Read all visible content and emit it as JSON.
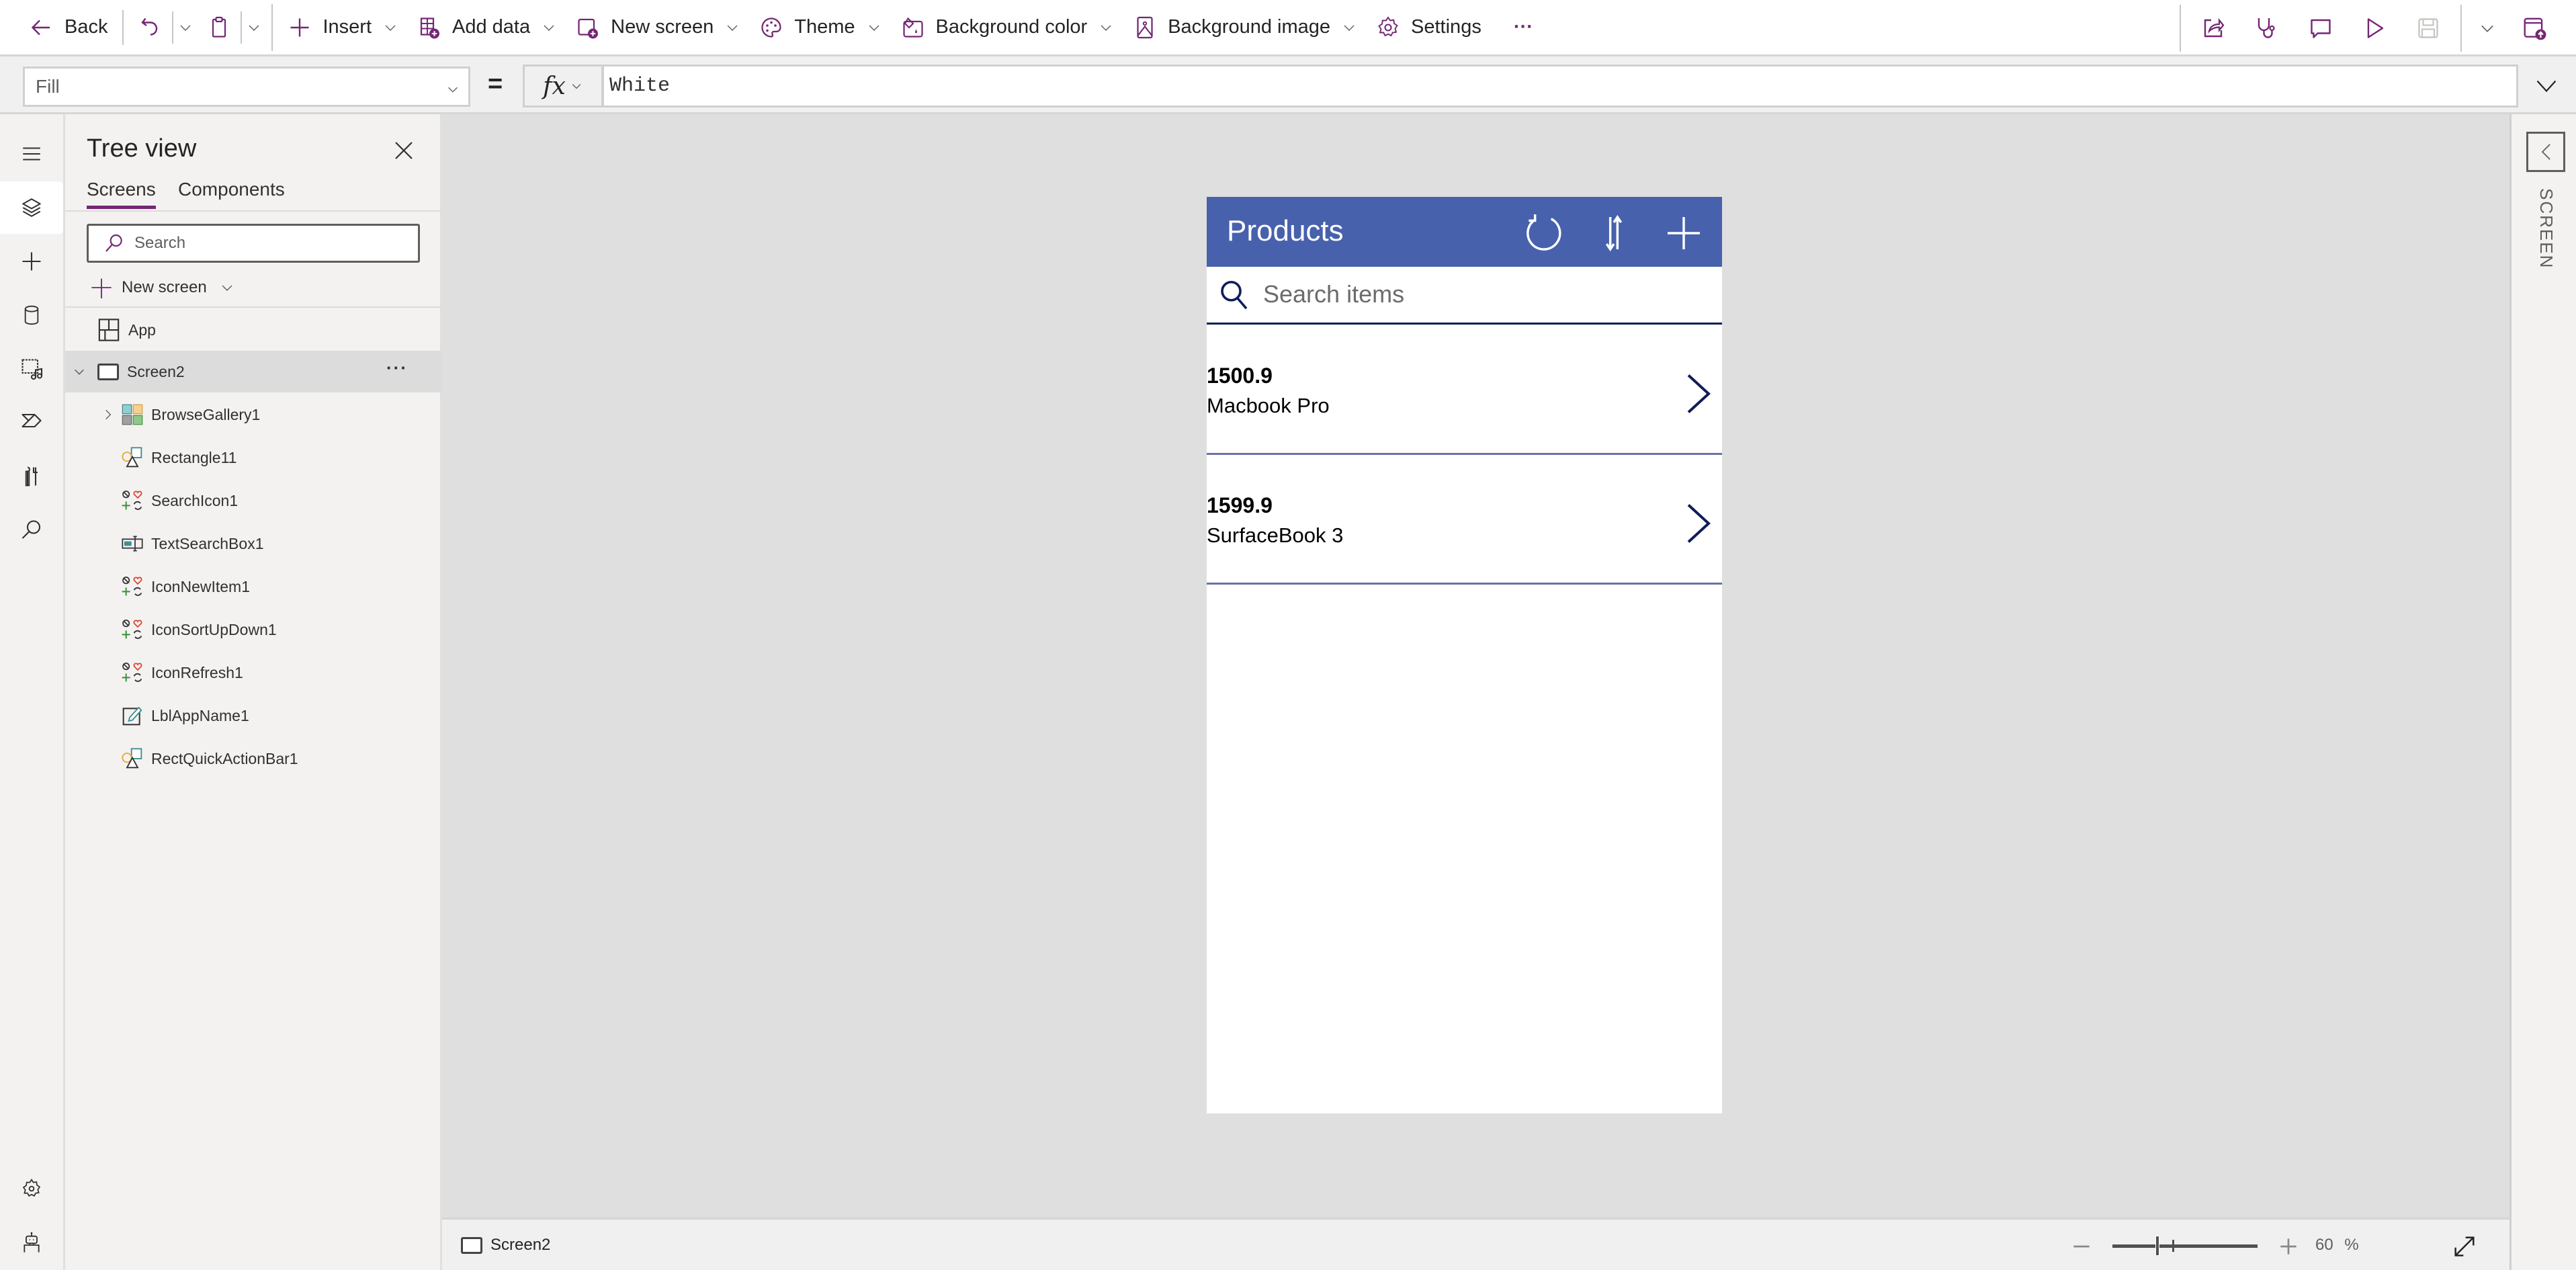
{
  "toolbar": {
    "back_label": "Back",
    "insert_label": "Insert",
    "add_data_label": "Add data",
    "new_screen_label": "New screen",
    "theme_label": "Theme",
    "background_color_label": "Background color",
    "background_image_label": "Background image",
    "settings_label": "Settings",
    "more_label": "···",
    "accent_color": "#742774"
  },
  "formula_bar": {
    "property": "Fill",
    "equals": "=",
    "fx_label": "fx",
    "formula": "White"
  },
  "tree_view": {
    "title": "Tree view",
    "tabs": [
      {
        "label": "Screens",
        "active": true
      },
      {
        "label": "Components",
        "active": false
      }
    ],
    "search_placeholder": "Search",
    "new_screen_label": "New screen",
    "app_label": "App",
    "screen": {
      "label": "Screen2",
      "expanded": true,
      "selected": true
    },
    "controls": [
      {
        "label": "BrowseGallery1",
        "icon": "gallery-icon",
        "expandable": true
      },
      {
        "label": "Rectangle11",
        "icon": "shapes-icon"
      },
      {
        "label": "SearchIcon1",
        "icon": "icons-control-icon"
      },
      {
        "label": "TextSearchBox1",
        "icon": "text-input-icon"
      },
      {
        "label": "IconNewItem1",
        "icon": "icons-control-icon"
      },
      {
        "label": "IconSortUpDown1",
        "icon": "icons-control-icon"
      },
      {
        "label": "IconRefresh1",
        "icon": "icons-control-icon"
      },
      {
        "label": "LblAppName1",
        "icon": "label-icon"
      },
      {
        "label": "RectQuickActionBar1",
        "icon": "shapes-icon"
      }
    ]
  },
  "app": {
    "title": "Products",
    "header_color": "#4761ad",
    "search_placeholder": "Search items",
    "items": [
      {
        "price": "1500.9",
        "name": "Macbook Pro"
      },
      {
        "price": "1599.9",
        "name": "SurfaceBook 3"
      }
    ]
  },
  "right_panel": {
    "label": "SCREEN"
  },
  "status_bar": {
    "screen_name": "Screen2",
    "zoom_value": "60",
    "zoom_unit": "%",
    "zoom_slider_fraction": 0.31
  }
}
